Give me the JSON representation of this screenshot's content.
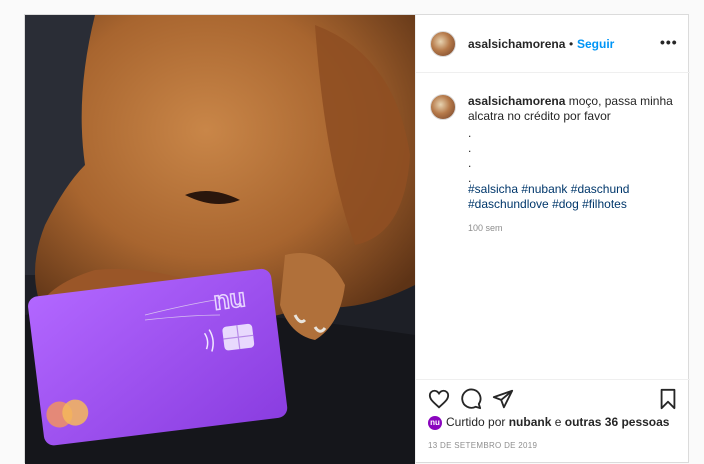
{
  "post": {
    "author": "asalsichamorena",
    "separator": "•",
    "follow_label": "Seguir",
    "more_label": "•••",
    "caption_text": "moço, passa minha alcatra no crédito por favor",
    "caption_dots": [
      ".",
      ".",
      ".",
      "."
    ],
    "hashtags_line1": [
      "#salsicha",
      "#nubank",
      "#daschund"
    ],
    "hashtags_line2": [
      "#daschundlove",
      "#dog",
      "#filhotes"
    ],
    "caption_time": "100 sem",
    "liked_prefix": "Curtido por",
    "liked_user": "nubank",
    "liked_connector": "e",
    "liked_others": "outras 36 pessoas",
    "date": "13 DE SETEMBRO DE 2019",
    "card_logo": "nu"
  },
  "icons": {
    "like": "heart-icon",
    "comment": "comment-icon",
    "share": "send-icon",
    "save": "bookmark-icon"
  },
  "colors": {
    "link": "#0095f6",
    "hashtag": "#00376b",
    "card": "#9b45f0",
    "nubank": "#8a05be"
  }
}
